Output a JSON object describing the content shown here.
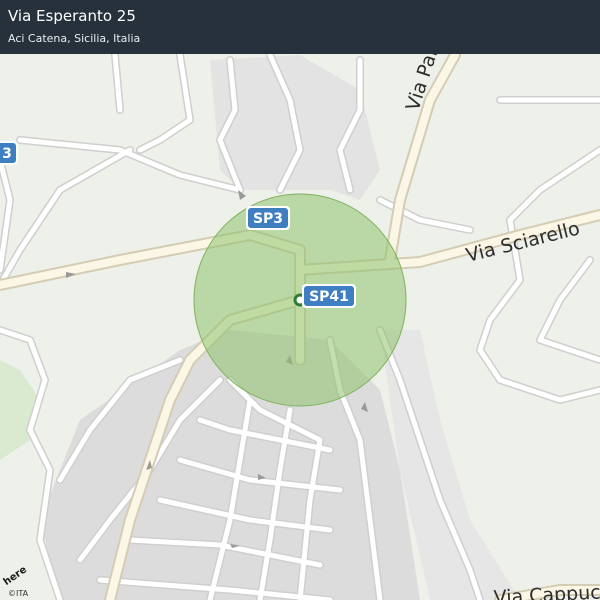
{
  "header": {
    "title": "Via Esperanto 25",
    "subtitle": "Aci Catena, Sicilia, Italia"
  },
  "map": {
    "street_labels": [
      "Via Partinico",
      "Via Sciarello",
      "Via Cappuccini"
    ],
    "shields": [
      "SP3",
      "SP41",
      "3"
    ],
    "attribution": "©ITA",
    "logo": "here",
    "colors": {
      "background": "#eef0ea",
      "road": "#ffffff",
      "major_road": "#fbf6e6",
      "road_outline": "#cfcfcf",
      "urban": "#dcdcdc",
      "park": "#d9ead0",
      "radius_fill": "#8fc36d",
      "shield": "#3f7fc1",
      "header": "#26313b"
    },
    "icons": [
      "location-marker-icon",
      "one-way-arrow-icon"
    ]
  }
}
